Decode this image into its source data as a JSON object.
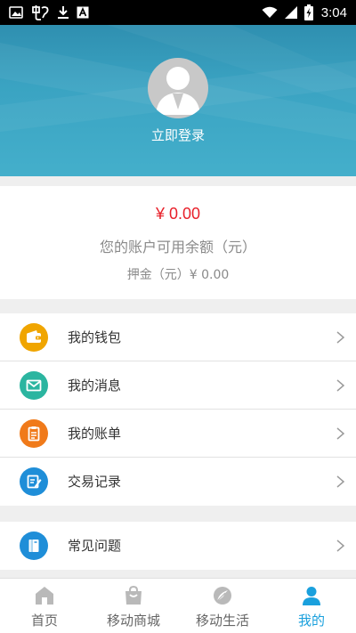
{
  "status_bar": {
    "time": "3:04",
    "left_icons": [
      "image-icon",
      "chinese-char-icon",
      "download-icon",
      "font-a-icon"
    ],
    "right_icons": [
      "wifi-icon",
      "signal-icon",
      "battery-charging-icon"
    ]
  },
  "header": {
    "login_text": "立即登录",
    "bg_color": "#3aa3c2"
  },
  "balance": {
    "amount": "¥ 0.00",
    "label": "您的账户可用余额（元）",
    "deposit": "押金（元）¥  0.00",
    "amount_color": "#e8202a"
  },
  "menu_group_1": [
    {
      "label": "我的钱包",
      "icon": "wallet-icon",
      "color": "#f0a500"
    },
    {
      "label": "我的消息",
      "icon": "envelope-icon",
      "color": "#2bb5a0"
    },
    {
      "label": "我的账单",
      "icon": "clipboard-icon",
      "color": "#f07a1a"
    },
    {
      "label": "交易记录",
      "icon": "edit-record-icon",
      "color": "#1f8ed8"
    }
  ],
  "menu_group_2": [
    {
      "label": "常见问题",
      "icon": "book-icon",
      "color": "#1f8ed8"
    }
  ],
  "tabbar": {
    "tabs": [
      {
        "label": "首页",
        "icon": "home-icon",
        "active": false
      },
      {
        "label": "移动商城",
        "icon": "shopping-bag-icon",
        "active": false
      },
      {
        "label": "移动生活",
        "icon": "feather-planet-icon",
        "active": false
      },
      {
        "label": "我的",
        "icon": "user-icon",
        "active": true
      }
    ],
    "active_color": "#1aa0dd",
    "inactive_color": "#b9b9b9"
  }
}
